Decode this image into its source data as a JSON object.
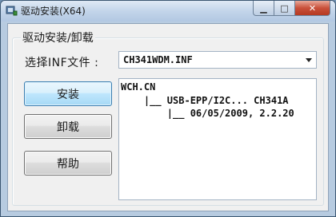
{
  "window": {
    "title": "驱动安装(X64)",
    "icon": "usb-app-icon",
    "controls": {
      "minimize": "minimize-icon",
      "maximize": "maximize-icon",
      "close": "close-icon"
    }
  },
  "group": {
    "label": "驱动安装/卸载"
  },
  "inf": {
    "label": "选择INF文件 :",
    "selected": "CH341WDM.INF"
  },
  "buttons": {
    "install": "安装",
    "uninstall": "卸载",
    "help": "帮助"
  },
  "info_tree": [
    "WCH.CN",
    "    |__ USB-EPP/I2C... CH341A",
    "        |__ 06/05/2009, 2.2.20"
  ],
  "colors": {
    "default_button": "#3c7fb1",
    "close_button": "#c9503a"
  }
}
